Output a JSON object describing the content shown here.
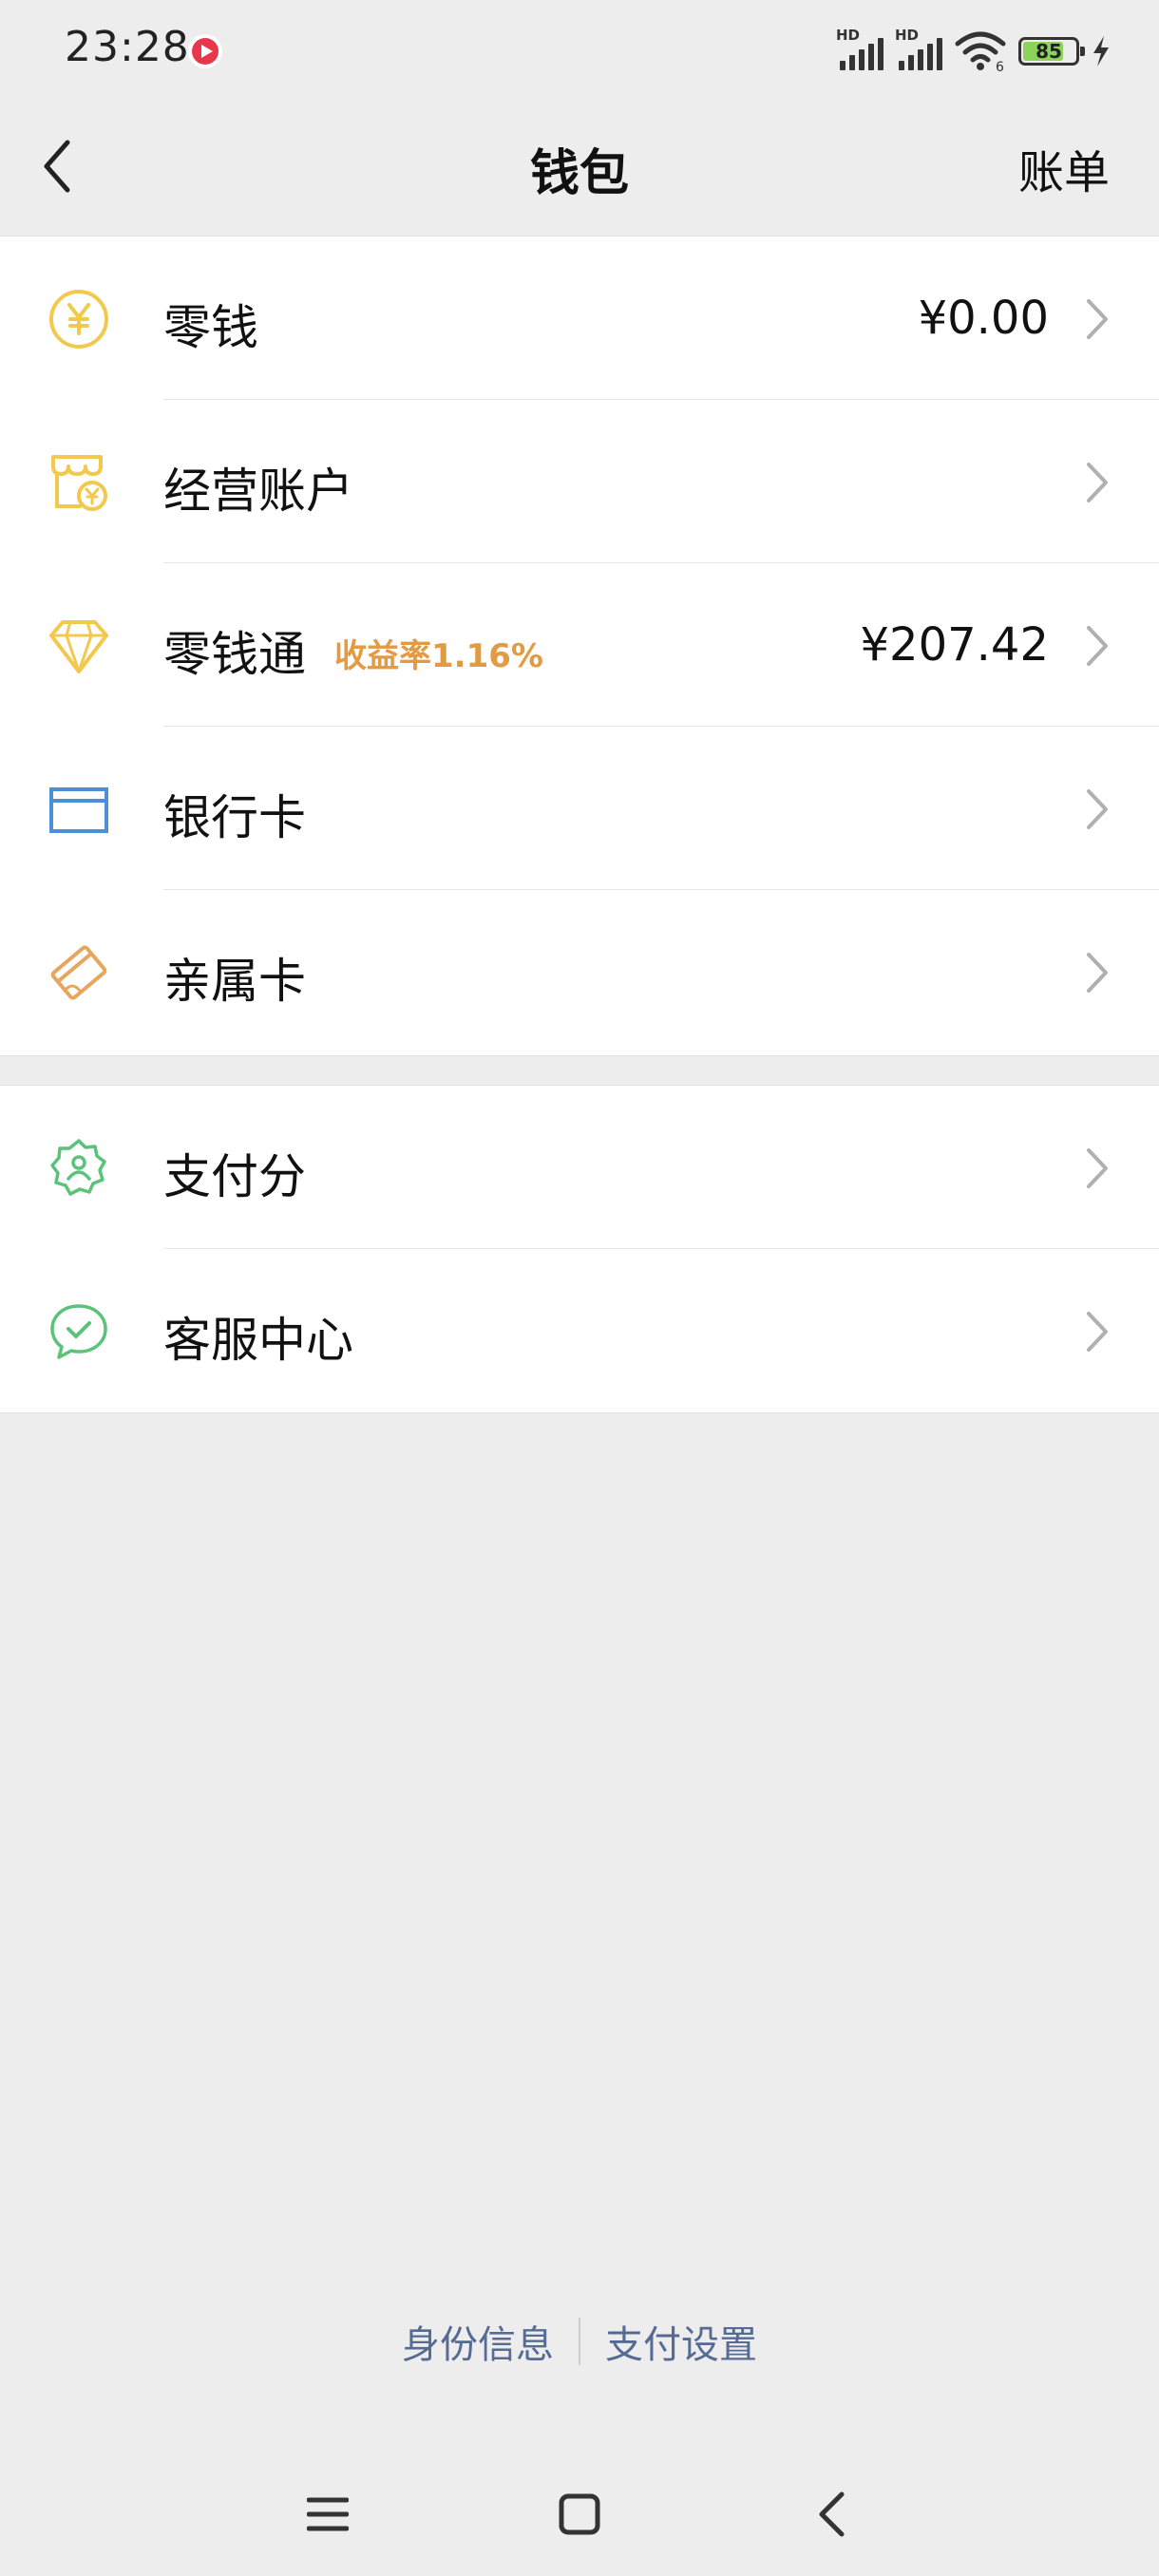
{
  "status_bar": {
    "time": "23:28",
    "network_label_1": "HD",
    "network_label_2": "HD",
    "wifi_label": "6",
    "battery_level": "85"
  },
  "nav": {
    "title": "钱包",
    "right_action": "账单"
  },
  "groups": [
    {
      "items": [
        {
          "label": "零钱",
          "value": "¥0.00",
          "icon": "yuan-coin-icon",
          "color": "#f2c94c"
        },
        {
          "label": "经营账户",
          "icon": "shop-account-icon",
          "color": "#f2c94c"
        },
        {
          "label": "零钱通",
          "badge": "收益率1.16%",
          "value": "¥207.42",
          "icon": "diamond-icon",
          "color": "#f2c94c"
        },
        {
          "label": "银行卡",
          "icon": "bank-card-icon",
          "color": "#4a90d9"
        },
        {
          "label": "亲属卡",
          "icon": "family-card-icon",
          "color": "#e8a55d"
        }
      ]
    },
    {
      "items": [
        {
          "label": "支付分",
          "icon": "pay-score-icon",
          "color": "#5bc27a"
        },
        {
          "label": "客服中心",
          "icon": "customer-service-icon",
          "color": "#5bc27a"
        }
      ]
    }
  ],
  "footer": {
    "link_1": "身份信息",
    "link_2": "支付设置"
  },
  "colors": {
    "background": "#ededed",
    "card": "#ffffff",
    "badge": "#e29a43",
    "link": "#566b94"
  }
}
